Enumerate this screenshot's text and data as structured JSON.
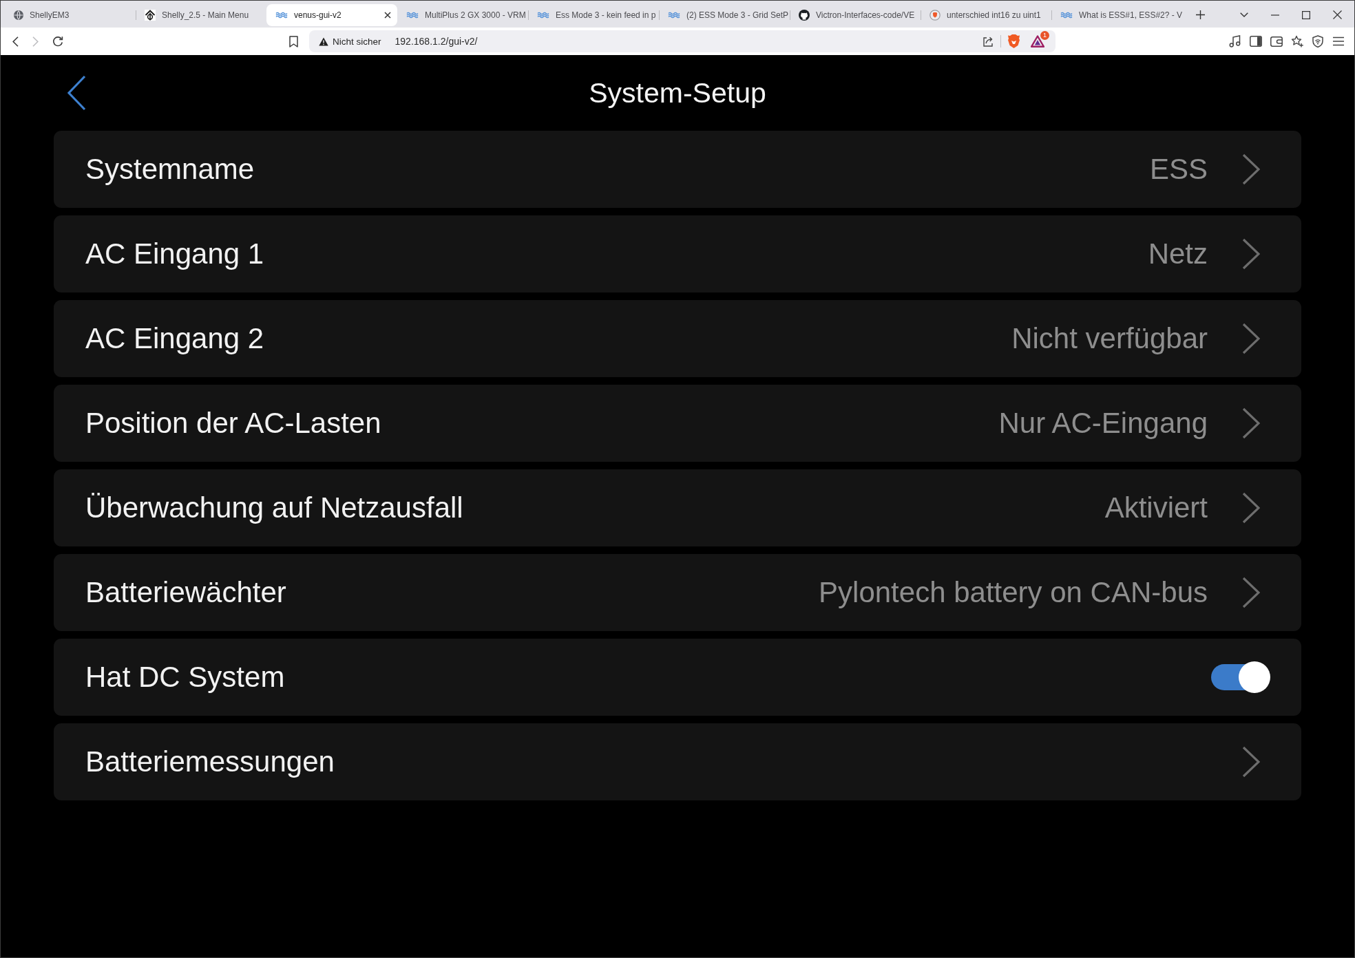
{
  "browser": {
    "tabs": [
      {
        "title": "ShellyEM3",
        "selected": false
      },
      {
        "title": "Shelly_2.5 - Main Menu",
        "selected": false
      },
      {
        "title": "venus-gui-v2",
        "selected": true
      },
      {
        "title": "MultiPlus 2 GX 3000 - VRM",
        "selected": false
      },
      {
        "title": "Ess Mode 3 - kein feed in p",
        "selected": false
      },
      {
        "title": "(2) ESS Mode 3 - Grid SetP",
        "selected": false
      },
      {
        "title": "Victron-Interfaces-code/VE",
        "selected": false
      },
      {
        "title": "unterschied int16 zu uint1",
        "selected": false
      },
      {
        "title": "What is ESS#1, ESS#2? - V",
        "selected": false
      }
    ],
    "nav_buttons": [
      {
        "kind": "back",
        "disabled": false
      },
      {
        "kind": "forward",
        "disabled": true
      },
      {
        "kind": "reload",
        "disabled": false
      }
    ],
    "address_bar": {
      "security_label": "Nicht sicher",
      "url": "192.168.1.2/gui-v2/"
    },
    "rewards_badge": "1"
  },
  "page": {
    "title": "System-Setup",
    "items": [
      {
        "kind": "link",
        "label": "Systemname",
        "value": "ESS"
      },
      {
        "kind": "link",
        "label": "AC Eingang 1",
        "value": "Netz"
      },
      {
        "kind": "link",
        "label": "AC Eingang 2",
        "value": "Nicht verfügbar"
      },
      {
        "kind": "link",
        "label": "Position der AC-Lasten",
        "value": "Nur AC-Eingang"
      },
      {
        "kind": "link",
        "label": "Überwachung auf Netzausfall",
        "value": "Aktiviert"
      },
      {
        "kind": "link",
        "label": "Batteriewächter",
        "value": "Pylontech battery on CAN-bus"
      },
      {
        "kind": "switch",
        "label": "Hat DC System",
        "on": true
      },
      {
        "kind": "link",
        "label": "Batteriemessungen"
      }
    ]
  }
}
